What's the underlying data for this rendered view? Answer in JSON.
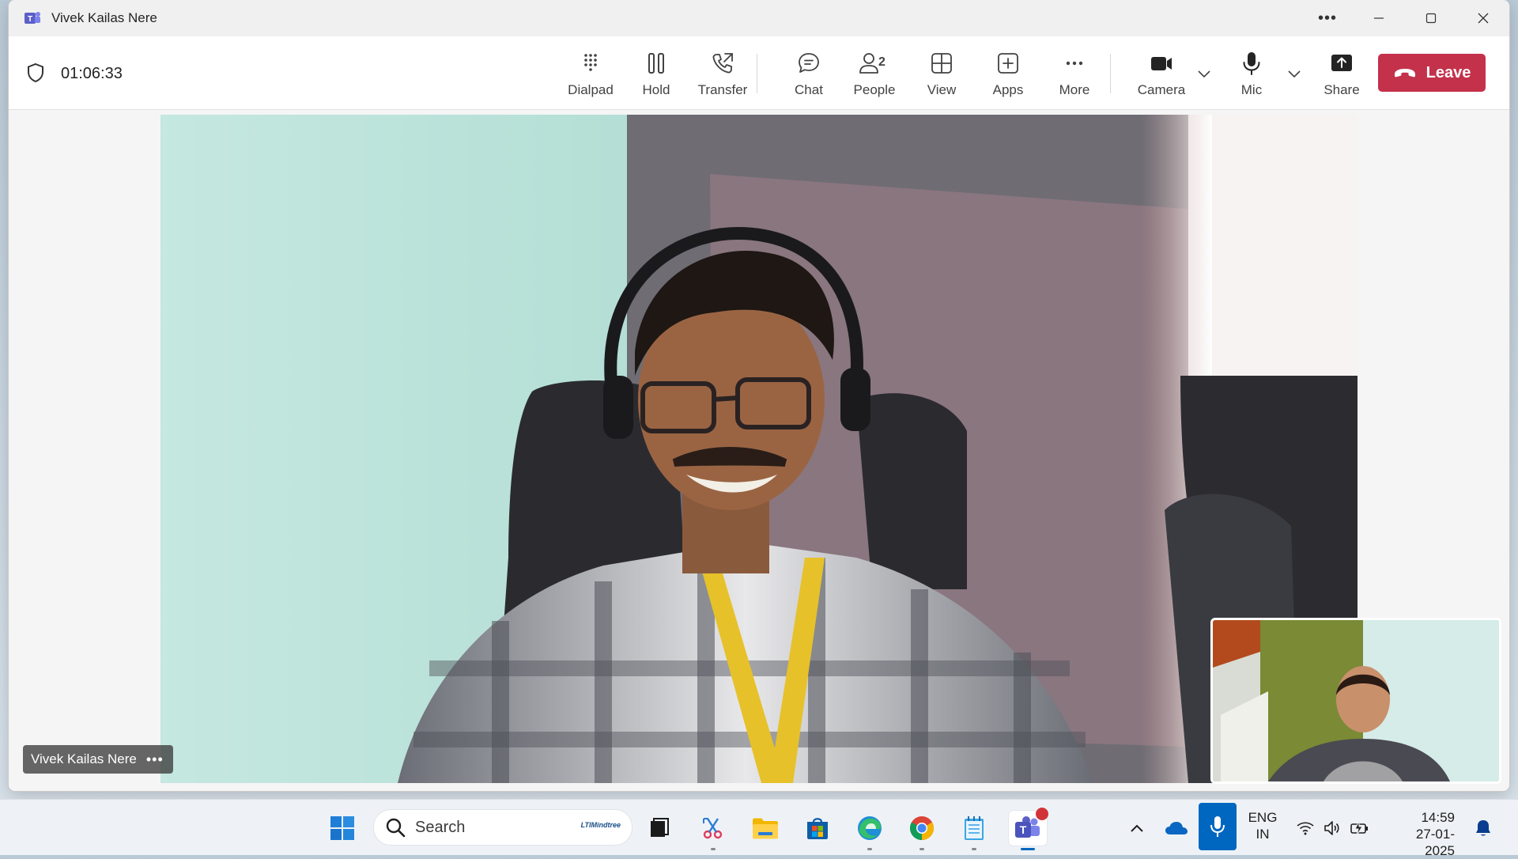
{
  "window": {
    "title": "Vivek Kailas Nere"
  },
  "call": {
    "timer": "01:06:33",
    "participant_count": "2",
    "toolbar": {
      "dialpad": "Dialpad",
      "hold": "Hold",
      "transfer": "Transfer",
      "chat": "Chat",
      "people": "People",
      "view": "View",
      "apps": "Apps",
      "more": "More",
      "camera": "Camera",
      "mic": "Mic",
      "share": "Share",
      "leave": "Leave"
    },
    "main_participant": {
      "name": "Vivek Kailas Nere"
    }
  },
  "taskbar": {
    "search_placeholder": "Search",
    "search_brand": "LTIMindtree",
    "language": "ENG",
    "region": "IN",
    "time": "14:59",
    "date": "27-01-2025",
    "icons": [
      "windows-start",
      "search",
      "task-view",
      "snipping-tool",
      "file-explorer",
      "microsoft-store",
      "edge",
      "chrome",
      "notepad",
      "teams"
    ]
  },
  "colors": {
    "leave": "#c4314b",
    "teams_purple": "#5b5fc7",
    "accent_blue": "#0067c0"
  }
}
